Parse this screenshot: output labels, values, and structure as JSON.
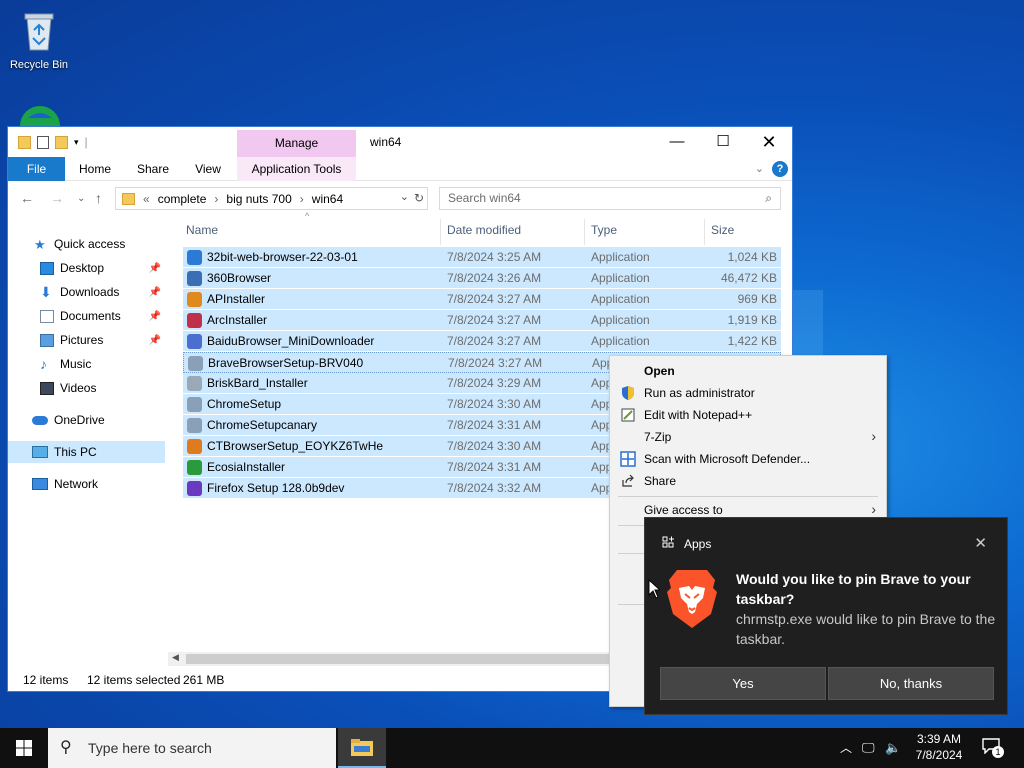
{
  "desktop": {
    "recycle_bin_label": "Recycle Bin"
  },
  "explorer": {
    "window_title": "win64",
    "contextual_tab_group": "Manage",
    "ribbon_tabs": [
      "File",
      "Home",
      "Share",
      "View",
      "Application Tools"
    ],
    "address": {
      "overflow": "«",
      "crumbs": [
        "complete",
        "big nuts 700",
        "win64"
      ]
    },
    "search_placeholder": "Search win64",
    "nav": {
      "quick_access": "Quick access",
      "desktop": "Desktop",
      "downloads": "Downloads",
      "documents": "Documents",
      "pictures": "Pictures",
      "music": "Music",
      "videos": "Videos",
      "onedrive": "OneDrive",
      "this_pc": "This PC",
      "network": "Network"
    },
    "columns": {
      "name": "Name",
      "date": "Date modified",
      "type": "Type",
      "size": "Size"
    },
    "files": [
      {
        "name": "32bit-web-browser-22-03-01",
        "date": "7/8/2024 3:25 AM",
        "type": "Application",
        "size": "1,024 KB",
        "icon_color": "#2a7bd6"
      },
      {
        "name": "360Browser",
        "date": "7/8/2024 3:26 AM",
        "type": "Application",
        "size": "46,472 KB",
        "icon_color": "#3b6fb5"
      },
      {
        "name": "APInstaller",
        "date": "7/8/2024 3:27 AM",
        "type": "Application",
        "size": "969 KB",
        "icon_color": "#e08a1e"
      },
      {
        "name": "ArcInstaller",
        "date": "7/8/2024 3:27 AM",
        "type": "Application",
        "size": "1,919 KB",
        "icon_color": "#c0304a"
      },
      {
        "name": "BaiduBrowser_MiniDownloader",
        "date": "7/8/2024 3:27 AM",
        "type": "Application",
        "size": "1,422 KB",
        "icon_color": "#4a6fd0"
      },
      {
        "name": "BraveBrowserSetup-BRV040",
        "date": "7/8/2024 3:27 AM",
        "type": "App",
        "size": "",
        "icon_color": "#8aa0b8"
      },
      {
        "name": "BriskBard_Installer",
        "date": "7/8/2024 3:29 AM",
        "type": "App",
        "size": "",
        "icon_color": "#9aa9b8"
      },
      {
        "name": "ChromeSetup",
        "date": "7/8/2024 3:30 AM",
        "type": "App",
        "size": "",
        "icon_color": "#8aa0b8"
      },
      {
        "name": "ChromeSetupcanary",
        "date": "7/8/2024 3:31 AM",
        "type": "App",
        "size": "",
        "icon_color": "#8aa0b8"
      },
      {
        "name": "CTBrowserSetup_EOYKZ6TwHe",
        "date": "7/8/2024 3:30 AM",
        "type": "App",
        "size": "",
        "icon_color": "#e07a1e"
      },
      {
        "name": "EcosiaInstaller",
        "date": "7/8/2024 3:31 AM",
        "type": "App",
        "size": "",
        "icon_color": "#2a9a3a"
      },
      {
        "name": "Firefox Setup 128.0b9dev",
        "date": "7/8/2024 3:32 AM",
        "type": "App",
        "size": "",
        "icon_color": "#6a3ac0"
      }
    ],
    "status": {
      "items": "12 items",
      "selected": "12 items selected",
      "size": "261 MB"
    }
  },
  "context_menu": {
    "items": [
      {
        "label": "Open",
        "bold": true,
        "icon": "",
        "submenu": false
      },
      {
        "label": "Run as administrator",
        "icon": "uac-shield-icon",
        "submenu": false
      },
      {
        "label": "Edit with Notepad++",
        "icon": "notepad-plus-icon",
        "submenu": false
      },
      {
        "label": "7-Zip",
        "icon": "",
        "submenu": true
      },
      {
        "label": "Scan with Microsoft Defender...",
        "icon": "defender-icon",
        "submenu": false
      },
      {
        "label": "Share",
        "icon": "share-icon",
        "submenu": false
      },
      {
        "label": "Give access to",
        "icon": "",
        "submenu": true
      }
    ]
  },
  "toast": {
    "app_name": "Apps",
    "title": "Would you like to pin Brave to your taskbar?",
    "body": "chrmstp.exe would like to pin Brave to the taskbar.",
    "yes_label": "Yes",
    "no_label": "No, thanks"
  },
  "taskbar": {
    "search_placeholder": "Type here to search",
    "time": "3:39 AM",
    "date": "7/8/2024",
    "notification_count": "1"
  }
}
